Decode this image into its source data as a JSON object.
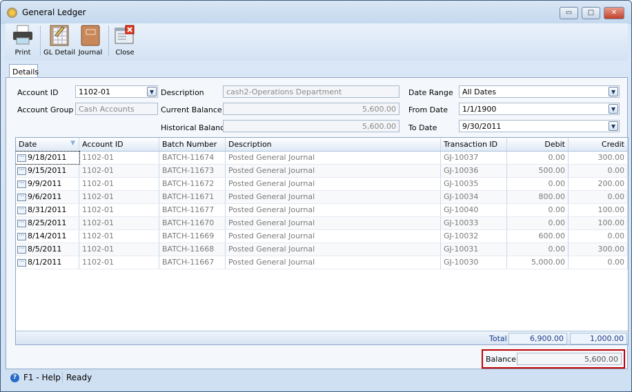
{
  "window": {
    "title": "General Ledger",
    "min": "▭",
    "max": "□",
    "close": "✕"
  },
  "toolbar": {
    "print": "Print",
    "gl_detail": "GL Detail",
    "journal": "Journal",
    "close": "Close"
  },
  "tabs": [
    {
      "label": "Details",
      "active": true
    }
  ],
  "form": {
    "account_id_label": "Account ID",
    "account_id": "1102-01",
    "account_group_label": "Account Group",
    "account_group": "Cash Accounts",
    "description_label": "Description",
    "description": "cash2-Operations Department",
    "current_balance_label": "Current Balance",
    "current_balance": "5,600.00",
    "historical_balance_label": "Historical Balance",
    "historical_balance": "5,600.00",
    "date_range_label": "Date Range",
    "date_range": "All Dates",
    "from_date_label": "From Date",
    "from_date": "1/1/1900",
    "to_date_label": "To Date",
    "to_date": "9/30/2011"
  },
  "grid": {
    "columns": [
      "Date",
      "Account ID",
      "Batch Number",
      "Description",
      "Transaction ID",
      "Debit",
      "Credit"
    ],
    "rows": [
      [
        "9/18/2011",
        "1102-01",
        "BATCH-11674",
        "Posted General Journal",
        "GJ-10037",
        "0.00",
        "300.00"
      ],
      [
        "9/15/2011",
        "1102-01",
        "BATCH-11673",
        "Posted General Journal",
        "GJ-10036",
        "500.00",
        "0.00"
      ],
      [
        "9/9/2011",
        "1102-01",
        "BATCH-11672",
        "Posted General Journal",
        "GJ-10035",
        "0.00",
        "200.00"
      ],
      [
        "9/6/2011",
        "1102-01",
        "BATCH-11671",
        "Posted General Journal",
        "GJ-10034",
        "800.00",
        "0.00"
      ],
      [
        "8/31/2011",
        "1102-01",
        "BATCH-11677",
        "Posted General Journal",
        "GJ-10040",
        "0.00",
        "100.00"
      ],
      [
        "8/25/2011",
        "1102-01",
        "BATCH-11670",
        "Posted General Journal",
        "GJ-10033",
        "0.00",
        "100.00"
      ],
      [
        "8/14/2011",
        "1102-01",
        "BATCH-11669",
        "Posted General Journal",
        "GJ-10032",
        "600.00",
        "0.00"
      ],
      [
        "8/5/2011",
        "1102-01",
        "BATCH-11668",
        "Posted General Journal",
        "GJ-10031",
        "0.00",
        "300.00"
      ],
      [
        "8/1/2011",
        "1102-01",
        "BATCH-11667",
        "Posted General Journal",
        "GJ-10030",
        "5,000.00",
        "0.00"
      ]
    ],
    "total_label": "Total",
    "total_debit": "6,900.00",
    "total_credit": "1,000.00"
  },
  "balance": {
    "label": "Balance",
    "value": "5,600.00"
  },
  "status": {
    "help": "F1 - Help",
    "state": "Ready"
  }
}
